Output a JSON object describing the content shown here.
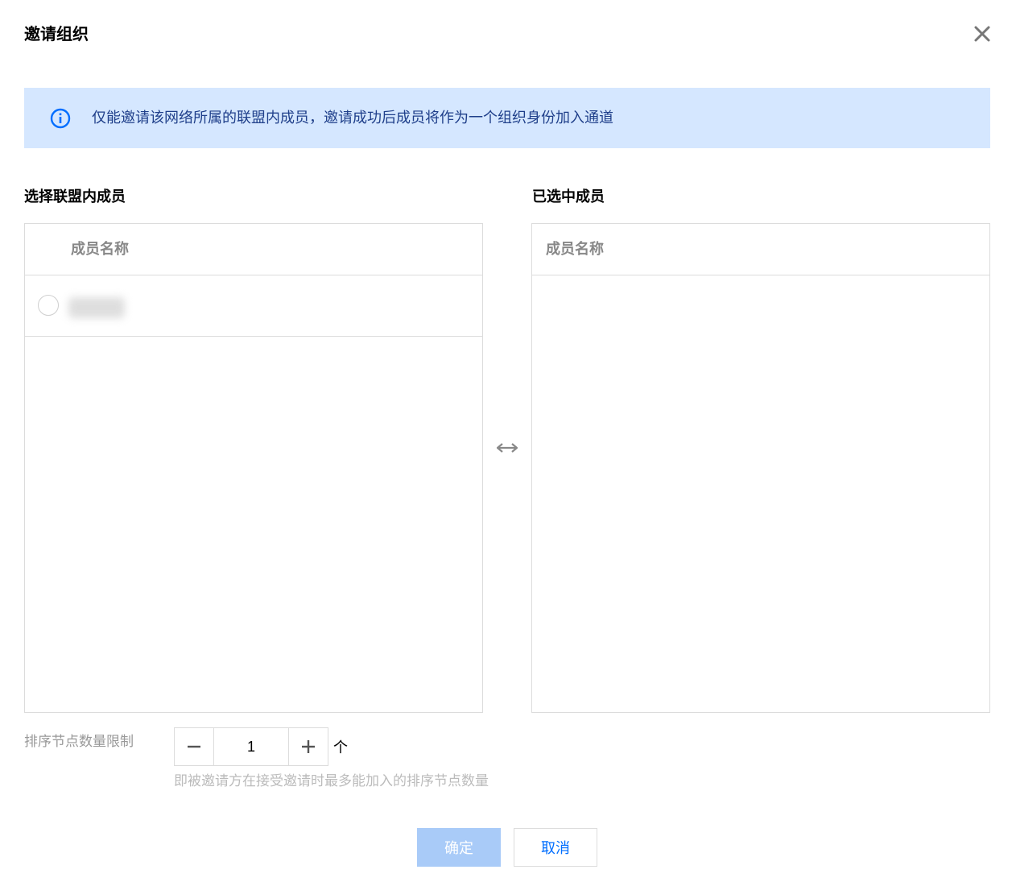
{
  "dialog": {
    "title": "邀请组织"
  },
  "banner": {
    "text": "仅能邀请该网络所属的联盟内成员，邀请成功后成员将作为一个组织身份加入通道",
    "icon": "info-icon",
    "color": "#d5e7ff"
  },
  "left_panel": {
    "label": "选择联盟内成员",
    "column_header": "成员名称",
    "rows": [
      {
        "name_hidden": true
      }
    ]
  },
  "right_panel": {
    "label": "已选中成员",
    "column_header": "成员名称"
  },
  "transfer": {
    "icon": "transfer-arrows-icon"
  },
  "limit": {
    "label": "排序节点数量限制",
    "value": "1",
    "unit": "个",
    "hint": "即被邀请方在接受邀请时最多能加入的排序节点数量"
  },
  "footer": {
    "confirm_label": "确定",
    "cancel_label": "取消"
  },
  "colors": {
    "accent": "#006eff",
    "confirm_disabled": "#a9cbf8"
  }
}
